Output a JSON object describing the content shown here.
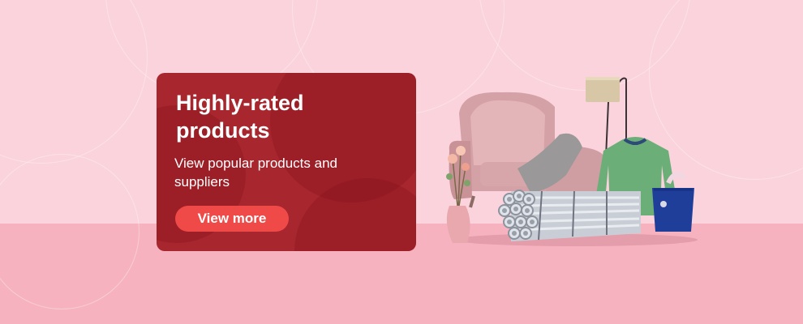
{
  "card": {
    "title": "Highly-rated products",
    "subtitle": "View popular products and suppliers",
    "cta_label": "View more"
  },
  "colors": {
    "background": "#fbd3dc",
    "floor": "#f6b3bf",
    "card": "#a8262e",
    "cta": "#f04a48"
  },
  "illustration": {
    "icons": [
      "armchair-icon",
      "floor-lamp-icon",
      "sweater-icon",
      "steel-pipes-icon",
      "flower-vase-icon",
      "tote-bag-icon"
    ]
  }
}
